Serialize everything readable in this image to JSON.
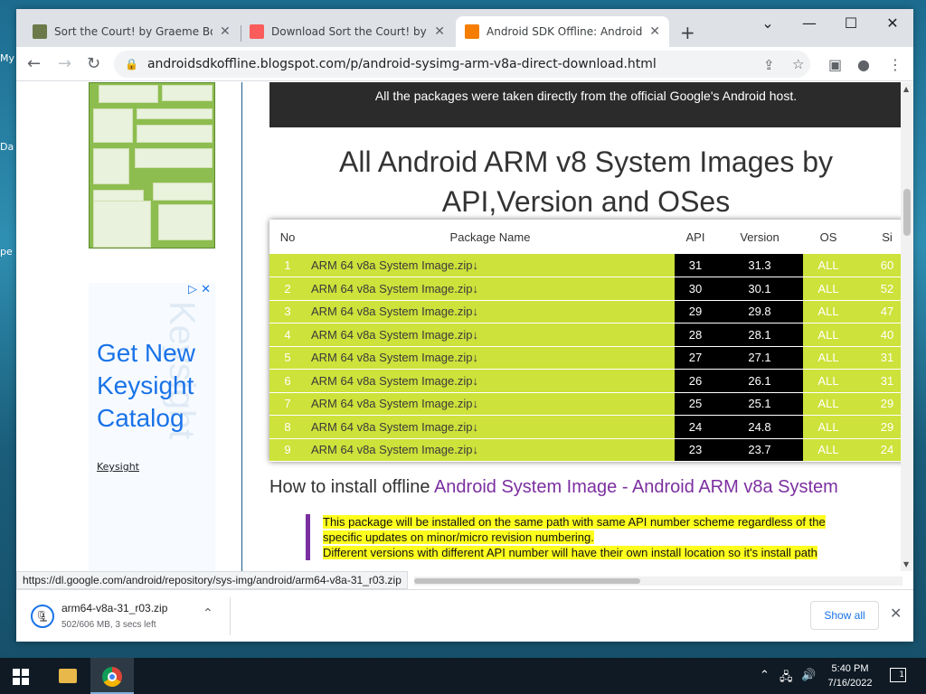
{
  "desktop": {
    "icon_labels": [
      "My",
      "Da",
      "pe"
    ]
  },
  "tabs": [
    {
      "title": "Sort the Court! by Graeme Borland",
      "favicon": "game-thumbnail-icon",
      "active": false
    },
    {
      "title": "Download Sort the Court! by Graeme Borland",
      "favicon": "itchio-icon",
      "active": false
    },
    {
      "title": "Android SDK Offline: Android System",
      "favicon": "blogger-icon",
      "active": true
    }
  ],
  "window_controls": {
    "minimize": "—",
    "maximize": "☐",
    "close": "✕",
    "tab_search": "⌄"
  },
  "toolbar": {
    "url": "androidsdkoffline.blogspot.com/p/android-sysimg-arm-v8a-direct-download.html",
    "back": "←",
    "forward": "→",
    "reload": "↻"
  },
  "page": {
    "banner_text": "All the packages were taken directly from the official Google's Android host.",
    "heading": "All Android ARM v8 System Images by API,Version and OSes",
    "table": {
      "headers": [
        "No",
        "Package Name",
        "API",
        "Version",
        "OS",
        "Si"
      ],
      "rows": [
        {
          "no": "1",
          "pkg": "ARM 64 v8a System Image.zip↓",
          "api": "31",
          "ver": "31.3",
          "os": "ALL",
          "size": "60"
        },
        {
          "no": "2",
          "pkg": "ARM 64 v8a System Image.zip↓",
          "api": "30",
          "ver": "30.1",
          "os": "ALL",
          "size": "52"
        },
        {
          "no": "3",
          "pkg": "ARM 64 v8a System Image.zip↓",
          "api": "29",
          "ver": "29.8",
          "os": "ALL",
          "size": "47"
        },
        {
          "no": "4",
          "pkg": "ARM 64 v8a System Image.zip↓",
          "api": "28",
          "ver": "28.1",
          "os": "ALL",
          "size": "40"
        },
        {
          "no": "5",
          "pkg": "ARM 64 v8a System Image.zip↓",
          "api": "27",
          "ver": "27.1",
          "os": "ALL",
          "size": "31"
        },
        {
          "no": "6",
          "pkg": "ARM 64 v8a System Image.zip↓",
          "api": "26",
          "ver": "26.1",
          "os": "ALL",
          "size": "31"
        },
        {
          "no": "7",
          "pkg": "ARM 64 v8a System Image.zip↓",
          "api": "25",
          "ver": "25.1",
          "os": "ALL",
          "size": "29"
        },
        {
          "no": "8",
          "pkg": "ARM 64 v8a System Image.zip↓",
          "api": "24",
          "ver": "24.8",
          "os": "ALL",
          "size": "29"
        },
        {
          "no": "9",
          "pkg": "ARM 64 v8a System Image.zip↓",
          "api": "23",
          "ver": "23.7",
          "os": "ALL",
          "size": "24"
        }
      ]
    },
    "subheading_prefix": "How to install offline ",
    "subheading_link": "Android System Image - Android ARM v8a System",
    "note_lines": [
      "This package will be installed on the same path with same API number scheme regardless of the",
      "specific updates on minor/micro revision numbering.",
      "Different versions with different API number will have their own install location so it's install path"
    ]
  },
  "ad": {
    "headline": "Get New Keysight Catalog",
    "brand": "Keysight",
    "watermark": "Keysight"
  },
  "status_url": "https://dl.google.com/android/repository/sys-img/android/arm64-v8a-31_r03.zip",
  "download": {
    "filename": "arm64-v8a-31_r03.zip",
    "status": "502/606 MB, 3 secs left",
    "show_all": "Show all",
    "progress": 0.828
  },
  "taskbar": {
    "time": "5:40 PM",
    "date": "7/16/2022",
    "notification_count": "1"
  },
  "colors": {
    "row_green": "#cde23a",
    "link_purple": "#7b2fa0",
    "note_highlight": "#ffff1e",
    "accent_blue": "#1a73e8"
  }
}
